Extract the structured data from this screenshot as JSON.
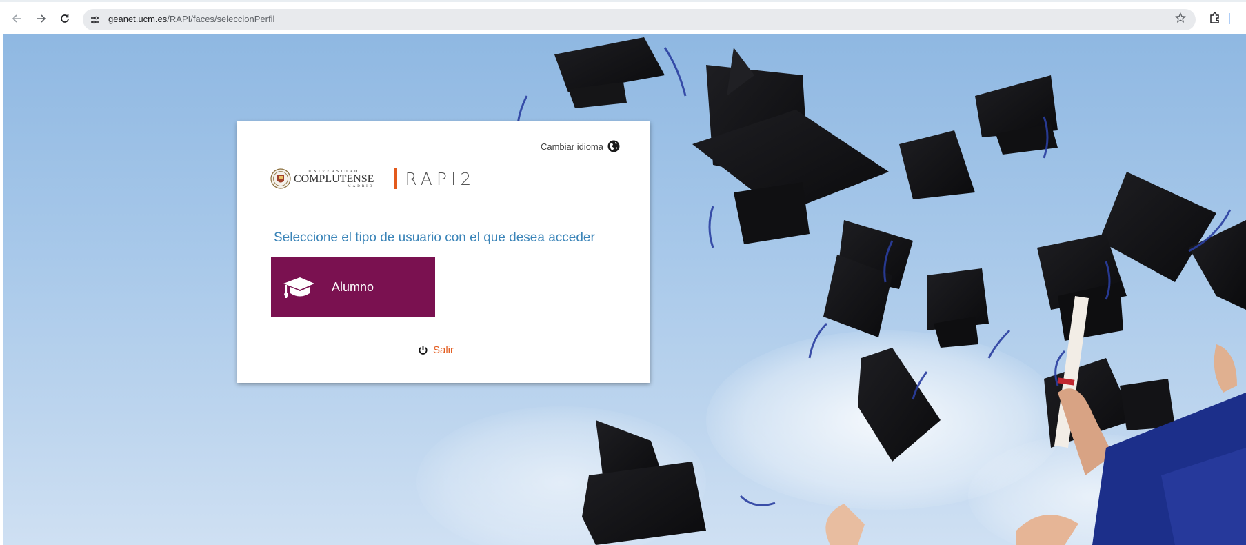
{
  "browser": {
    "url_host": "geanet.ucm.es",
    "url_path": "/RAPI/faces/seleccionPerfil",
    "back_icon": "arrow-left-icon",
    "forward_icon": "arrow-right-icon",
    "reload_icon": "reload-icon",
    "bookmark_icon": "star-icon",
    "extensions_icon": "puzzle-icon"
  },
  "card": {
    "language_label": "Cambiar idioma",
    "university": {
      "top": "UNIVERSIDAD",
      "name": "COMPLUTENSE",
      "bottom": "MADRID"
    },
    "app_name": "RAPI2",
    "prompt": "Seleccione el tipo de usuario con el que desea acceder",
    "profile_button": "Alumno",
    "logout_label": "Salir"
  },
  "colors": {
    "prompt": "#3a84b8",
    "profile_button_bg": "#7a1150",
    "accent_orange": "#e35a1c"
  }
}
